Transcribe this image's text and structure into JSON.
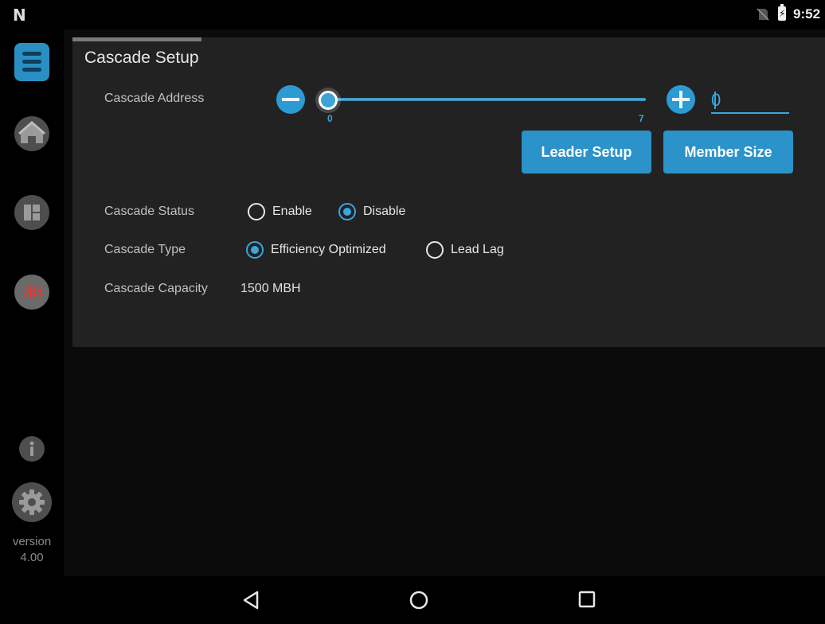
{
  "statusbar": {
    "logo": "N",
    "time": "9:52",
    "battery_glyph": "⚡"
  },
  "sidebar": {
    "items": [
      {
        "name": "menu",
        "icon": "menu-icon"
      },
      {
        "name": "home",
        "icon": "home-icon"
      },
      {
        "name": "dashboard",
        "icon": "dashboard-icon"
      },
      {
        "name": "controls",
        "icon": "sliders-icon"
      },
      {
        "name": "info",
        "icon": "info-icon"
      },
      {
        "name": "settings",
        "icon": "gear-icon"
      }
    ],
    "version_label": "version",
    "version_number": "4.00"
  },
  "panel": {
    "title": "Cascade Setup",
    "address": {
      "label": "Cascade Address",
      "min_label": "0",
      "max_label": "7",
      "value": 0,
      "min": 0,
      "max": 7,
      "input_value": "0"
    },
    "buttons": {
      "leader_setup": "Leader Setup",
      "member_size": "Member Size"
    },
    "status": {
      "label": "Cascade Status",
      "options": [
        "Enable",
        "Disable"
      ],
      "selected": "Disable"
    },
    "type": {
      "label": "Cascade Type",
      "options": [
        "Efficiency Optimized",
        "Lead Lag"
      ],
      "selected": "Efficiency Optimized"
    },
    "capacity": {
      "label": "Cascade Capacity",
      "value": "1500 MBH"
    }
  },
  "colors": {
    "accent": "#2b93c9",
    "panel": "#222222",
    "background": "#0b0b0b",
    "controls_icon": "#e53935"
  },
  "navbar": {
    "items": [
      "back-icon",
      "home-circle-icon",
      "recents-icon"
    ]
  }
}
